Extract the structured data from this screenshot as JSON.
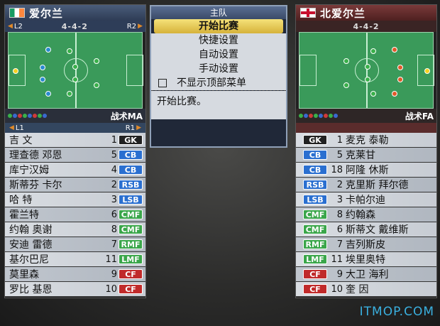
{
  "left_team": {
    "name": "爱尔兰",
    "flag": "flag-ireland-icon",
    "shoulder_left": "L2",
    "shoulder_right": "R2",
    "formation": "4-4-2",
    "tactic": "战术MA",
    "sub_left": "L1",
    "sub_right": "R1",
    "players": [
      {
        "name": "吉 文",
        "number": "1",
        "pos": "GK"
      },
      {
        "name": "理查德 邓恩",
        "number": "5",
        "pos": "CB"
      },
      {
        "name": "库宁汉姆",
        "number": "4",
        "pos": "CB"
      },
      {
        "name": "斯蒂芬 卡尔",
        "number": "2",
        "pos": "RSB"
      },
      {
        "name": "哈 特",
        "number": "3",
        "pos": "LSB"
      },
      {
        "name": "霍兰特",
        "number": "6",
        "pos": "CMF"
      },
      {
        "name": "约翰 奥谢",
        "number": "8",
        "pos": "CMF"
      },
      {
        "name": "安迪 雷德",
        "number": "7",
        "pos": "RMF"
      },
      {
        "name": "基尔巴尼",
        "number": "11",
        "pos": "LMF"
      },
      {
        "name": "莫里森",
        "number": "9",
        "pos": "CF"
      },
      {
        "name": "罗比 基恩",
        "number": "10",
        "pos": "CF"
      }
    ]
  },
  "right_team": {
    "name": "北爱尔兰",
    "flag": "flag-northern-ireland-icon",
    "formation": "4-4-2",
    "tactic": "战术FA",
    "players": [
      {
        "name": "麦克 泰勒",
        "number": "1",
        "pos": "GK"
      },
      {
        "name": "克莱甘",
        "number": "5",
        "pos": "CB"
      },
      {
        "name": "阿隆 休斯",
        "number": "18",
        "pos": "CB"
      },
      {
        "name": "克里斯 拜尔德",
        "number": "2",
        "pos": "RSB"
      },
      {
        "name": "卡帕尔迪",
        "number": "3",
        "pos": "LSB"
      },
      {
        "name": "约翰森",
        "number": "8",
        "pos": "CMF"
      },
      {
        "name": "斯蒂文 戴维斯",
        "number": "6",
        "pos": "CMF"
      },
      {
        "name": "吉列斯皮",
        "number": "7",
        "pos": "RMF"
      },
      {
        "name": "埃里奥特",
        "number": "11",
        "pos": "LMF"
      },
      {
        "name": "大卫 海利",
        "number": "9",
        "pos": "CF"
      },
      {
        "name": "奎 因",
        "number": "10",
        "pos": "CF"
      }
    ]
  },
  "menu": {
    "title": "主队",
    "items": [
      "开始比赛",
      "快捷设置",
      "自动设置",
      "手动设置"
    ],
    "checkbox_label": "不显示顶部菜单",
    "description": "开始比赛。"
  },
  "watermark": "ITMOP.COM",
  "position_colors": {
    "GK": "#222222",
    "CB": "#2a6fd0",
    "RSB": "#2a6fd0",
    "LSB": "#2a6fd0",
    "CMF": "#3aa64a",
    "RMF": "#3aa64a",
    "LMF": "#3aa64a",
    "CF": "#c02a2a"
  }
}
